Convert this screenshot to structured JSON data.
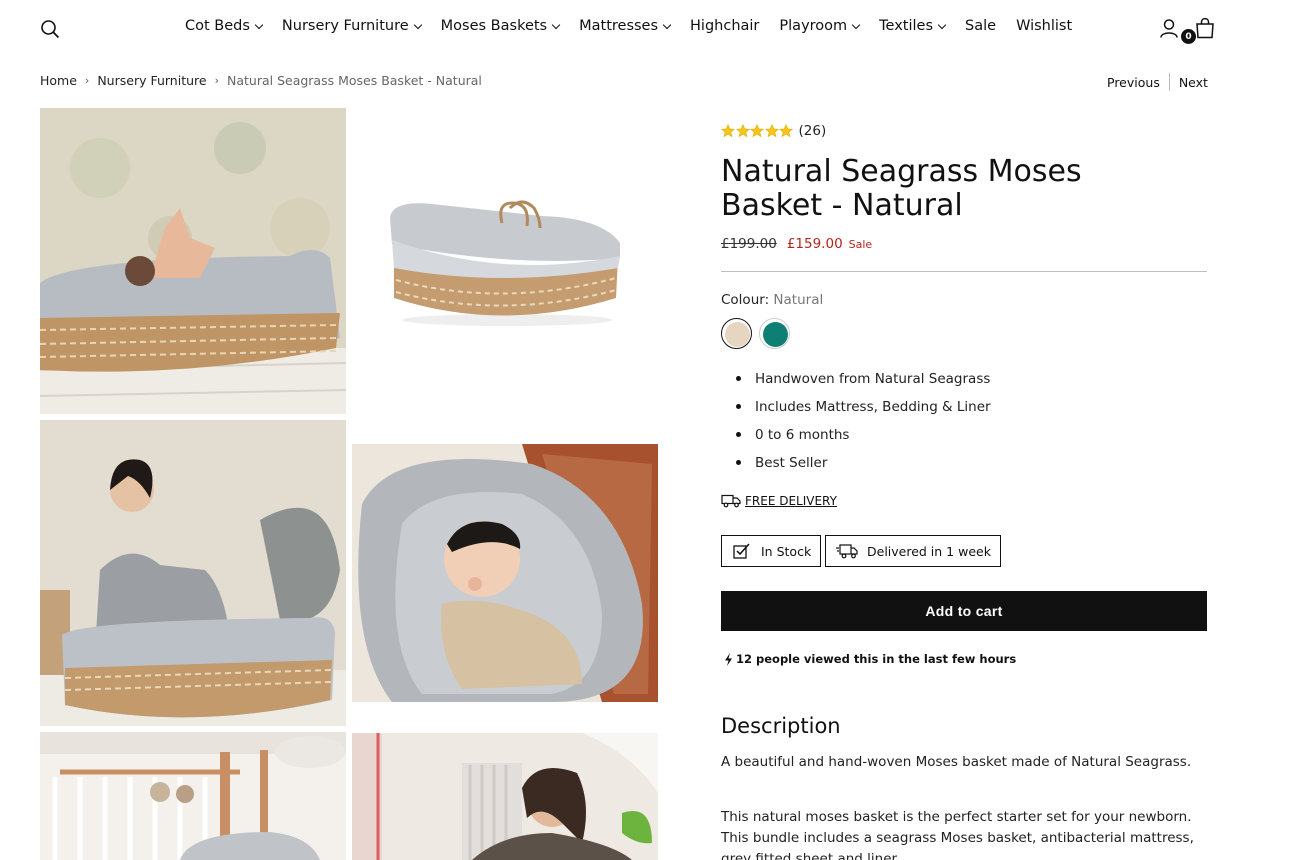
{
  "header": {
    "nav": [
      {
        "label": "Cot Beds",
        "dropdown": true
      },
      {
        "label": "Nursery Furniture",
        "dropdown": true
      },
      {
        "label": "Moses Baskets",
        "dropdown": true
      },
      {
        "label": "Mattresses",
        "dropdown": true
      },
      {
        "label": "Highchair",
        "dropdown": false
      },
      {
        "label": "Playroom",
        "dropdown": true
      },
      {
        "label": "Textiles",
        "dropdown": true
      },
      {
        "label": "Sale",
        "dropdown": false
      },
      {
        "label": "Wishlist",
        "dropdown": false
      }
    ],
    "cart_count": "0"
  },
  "breadcrumb": {
    "home": "Home",
    "category": "Nursery Furniture",
    "current": "Natural Seagrass Moses Basket - Natural"
  },
  "pager": {
    "previous": "Previous",
    "next": "Next"
  },
  "product": {
    "rating_stars": 5,
    "rating_count": "(26)",
    "title": "Natural Seagrass Moses Basket - Natural",
    "old_price": "£199.00",
    "price": "£159.00",
    "sale_label": "Sale",
    "colour_label": "Colour:",
    "colour_value": "Natural",
    "swatches": [
      {
        "name": "Natural",
        "color": "#e6d5c1",
        "selected": true
      },
      {
        "name": "Teal",
        "color": "#0f7f74",
        "selected": false
      }
    ],
    "features": [
      "Handwoven from Natural Seagrass",
      "Includes Mattress, Bedding & Liner",
      "0 to 6 months",
      "Best Seller"
    ],
    "delivery_link": "FREE DELIVERY",
    "stock_badge": "In Stock",
    "delivery_badge": "Delivered in 1 week",
    "add_to_cart": "Add to cart",
    "viewers": "12 people viewed this in the last few hours",
    "description_title": "Description",
    "description": [
      "A beautiful and hand-woven Moses basket made of Natural Seagrass.",
      "This natural moses basket is the perfect starter set for your newborn. This bundle includes a seagrass Moses basket, antibacterial mattress, grey fitted sheet and liner."
    ]
  },
  "colors": {
    "accent": "#111111",
    "sale": "#b3261e",
    "star": "#f5c518"
  }
}
